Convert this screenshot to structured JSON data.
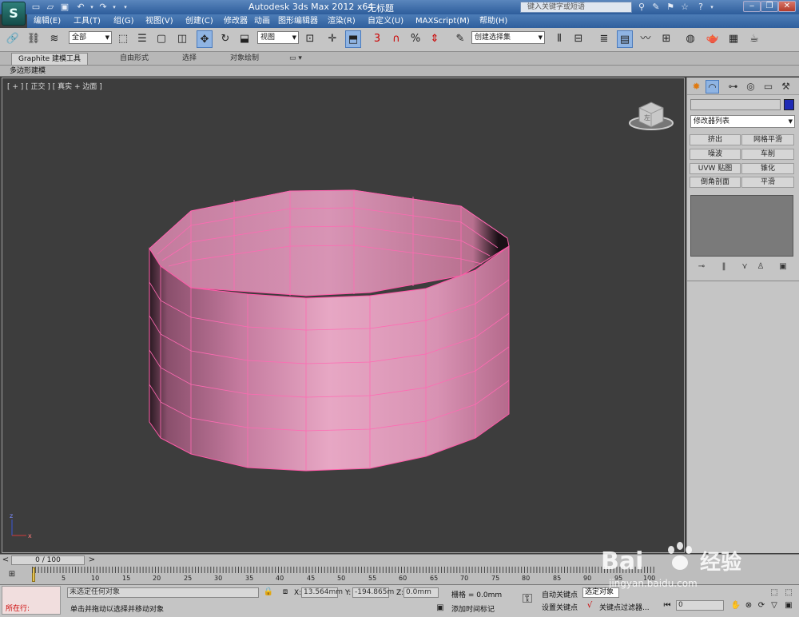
{
  "app_icon": "S",
  "title": {
    "app": "Autodesk 3ds Max  2012 x64",
    "document": "无标题",
    "search_placeholder": "键入关键字或短语"
  },
  "menu": [
    "编辑(E)",
    "工具(T)",
    "组(G)",
    "视图(V)",
    "创建(C)",
    "修改器",
    "动画",
    "图形编辑器",
    "渲染(R)",
    "自定义(U)",
    "MAXScript(M)",
    "帮助(H)"
  ],
  "toolbar": {
    "selection_filter": "全部",
    "reference_coord": "视图",
    "named_selection": "创建选择集",
    "snap_label": "3",
    "percent_snap": "%"
  },
  "ribbon": {
    "tabs": [
      "Graphite 建模工具",
      "自由形式",
      "选择",
      "对象绘制"
    ],
    "sub_label": "多边形建模"
  },
  "viewport": {
    "label": "[ + ] [ 正交 ] [ 真实 + 边面 ]",
    "viewcube_label": "左",
    "axis_x": "x",
    "axis_z": "z",
    "mesh_color": "#d98bb0",
    "edge_color": "#ff5aa8"
  },
  "command_panel": {
    "modifier_list": "修改器列表",
    "buttons": [
      [
        "挤出",
        "网格平滑"
      ],
      [
        "噪波",
        "车削"
      ],
      [
        "UVW 贴图",
        "锥化"
      ],
      [
        "倒角剖面",
        "平滑"
      ]
    ],
    "object_color": "#1f2bb5"
  },
  "timeline": {
    "slider": "0 / 100",
    "ticks": [
      "5",
      "10",
      "15",
      "20",
      "25",
      "30",
      "35",
      "40",
      "45",
      "50",
      "55",
      "60",
      "65",
      "70",
      "75",
      "80",
      "85",
      "90",
      "95",
      "100"
    ]
  },
  "status": {
    "maxscript_label": "所在行:",
    "line1": "未选定任何对象",
    "line2": "单击并拖动以选择并移动对象",
    "x_label": "X:",
    "x_value": "13.564mm",
    "y_label": "Y:",
    "y_value": "-194.865m",
    "z_label": "Z:",
    "z_value": "0.0mm",
    "grid": "栅格 = 0.0mm",
    "add_time_tag": "添加时间标记",
    "auto_key": "自动关键点",
    "selected_obj": "选定对象",
    "set_key": "设置关键点",
    "key_filters": "关键点过滤器...",
    "frame_value": "0"
  },
  "watermark": {
    "brand": "Bai",
    "brand_suffix": "经验",
    "url": "jingyan.baidu.com"
  }
}
